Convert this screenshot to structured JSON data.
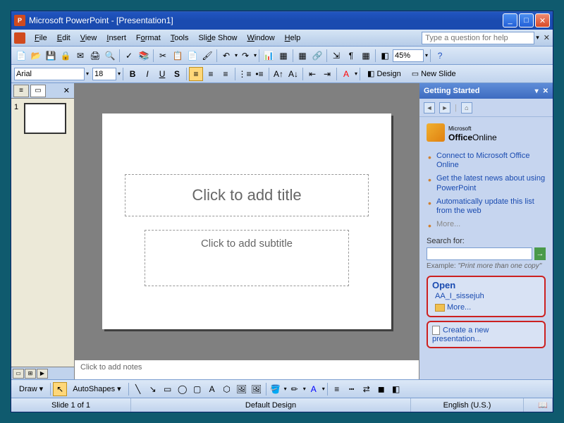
{
  "titlebar": {
    "title": "Microsoft PowerPoint - [Presentation1]"
  },
  "menu": {
    "file": "File",
    "edit": "Edit",
    "view": "View",
    "insert": "Insert",
    "format": "Format",
    "tools": "Tools",
    "slideshow": "Slide Show",
    "window": "Window",
    "help": "Help",
    "help_placeholder": "Type a question for help"
  },
  "toolbar": {
    "zoom": "45%"
  },
  "format_bar": {
    "font": "Arial",
    "size": "18",
    "bold": "B",
    "italic": "I",
    "underline": "U",
    "shadow": "S",
    "design_label": "Design",
    "new_slide_label": "New Slide"
  },
  "outline": {
    "slide_number": "1"
  },
  "slide": {
    "title_placeholder": "Click to add title",
    "subtitle_placeholder": "Click to add subtitle"
  },
  "notes": {
    "placeholder": "Click to add notes"
  },
  "task_pane": {
    "header": "Getting Started",
    "office_online_prefix": "Microsoft",
    "office_online_main": "Office",
    "office_online_suffix": "Online",
    "links": {
      "connect": "Connect to Microsoft Office Online",
      "news": "Get the latest news about using PowerPoint",
      "update": "Automatically update this list from the web",
      "more": "More..."
    },
    "search_label": "Search for:",
    "example_label": "Example:",
    "example_text": "\"Print more than one copy\"",
    "open_title": "Open",
    "open_recent": "AA_I_sissejuh",
    "open_more": "More...",
    "create_label": "Create a new presentation..."
  },
  "draw_bar": {
    "draw_label": "Draw",
    "autoshapes_label": "AutoShapes"
  },
  "status": {
    "slide": "Slide 1 of 1",
    "design": "Default Design",
    "language": "English (U.S.)"
  }
}
